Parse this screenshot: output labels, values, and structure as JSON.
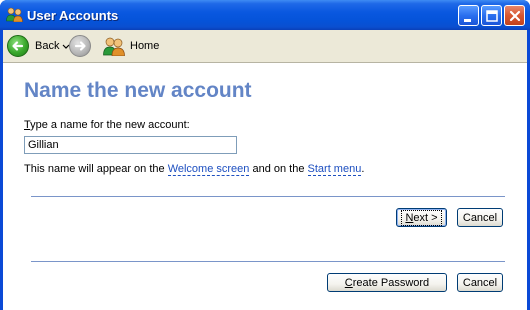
{
  "window": {
    "title": "User Accounts"
  },
  "toolbar": {
    "back_label": "Back",
    "home_label": "Home"
  },
  "page": {
    "heading": "Name the new account",
    "prompt_accesskey": "T",
    "prompt_rest": "ype a name for the new account:",
    "name_value": "Gillian",
    "info_prefix": "This name will appear on the ",
    "info_link_welcome": "Welcome screen",
    "info_middle": " and on the ",
    "info_link_start": "Start menu",
    "info_suffix": "."
  },
  "buttons": {
    "next_accesskey": "N",
    "next_rest": "ext >",
    "cancel_label": "Cancel",
    "create_password_accesskey": "C",
    "create_password_rest": "reate Password",
    "cancel2_label": "Cancel"
  },
  "colors": {
    "titlebar": "#0a58e0",
    "heading": "#6385c6",
    "link": "#1d4fc0",
    "toolbar_bg": "#ece9d8"
  }
}
